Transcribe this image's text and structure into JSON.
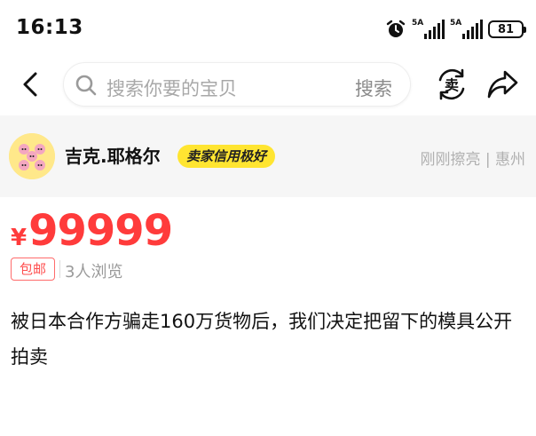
{
  "status_bar": {
    "time": "16:13",
    "alarm_icon": "alarm-clock-icon",
    "sim1_tag": "5A",
    "sim2_tag": "5A",
    "battery": "81"
  },
  "nav": {
    "back_icon": "chevron-left-icon",
    "search_placeholder": "搜索你要的宝贝",
    "search_button": "搜索",
    "sell_icon_label": "卖",
    "share_icon": "share-arrow-icon"
  },
  "seller": {
    "name": "吉克.耶格尔",
    "badge": "卖家信用极好",
    "meta": "刚刚擦亮 | 惠州"
  },
  "item": {
    "currency": "¥",
    "price": "99999",
    "shipping_tag": "包邮",
    "views": "3人浏览",
    "description": "被日本合作方骗走160万货物后，我们决定把留下的模具公开拍卖"
  },
  "colors": {
    "price": "#ff3b3b",
    "badge_bg": "#ffe531",
    "seller_bg": "#f6f6f6"
  }
}
